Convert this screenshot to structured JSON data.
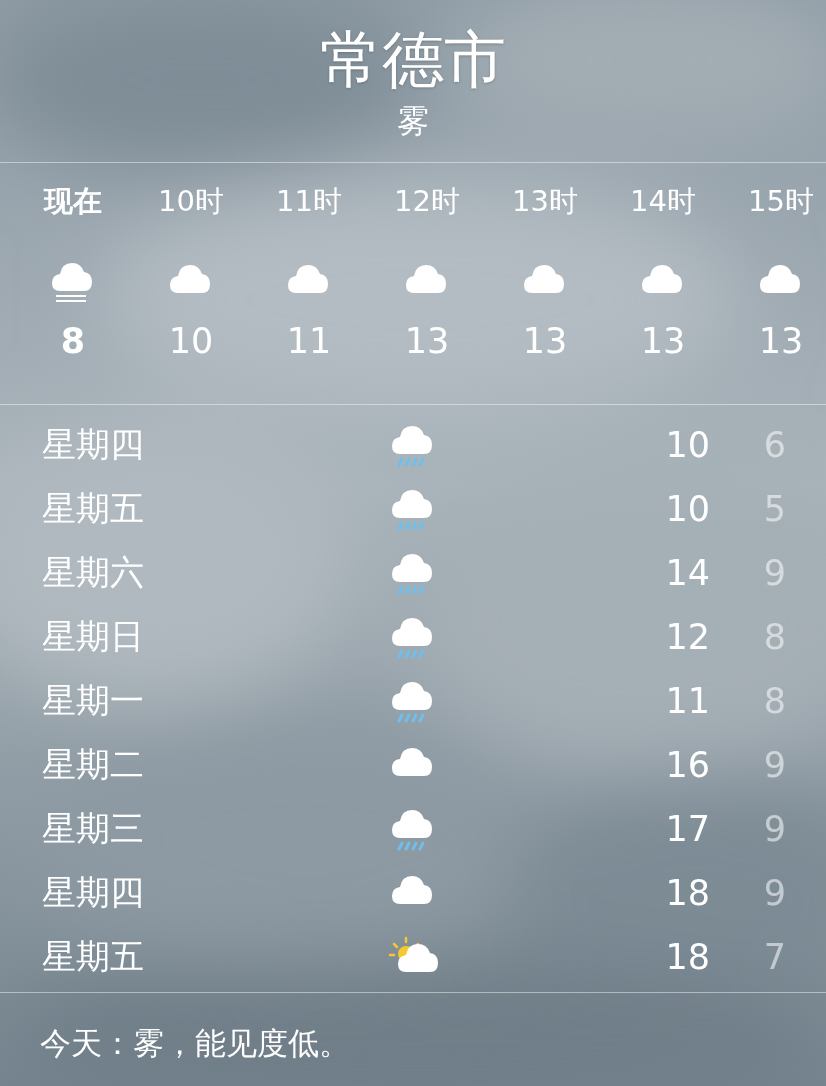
{
  "header": {
    "city": "常德市",
    "condition": "雾"
  },
  "hourly": [
    {
      "time": "现在",
      "kind": "fog",
      "temp": "8",
      "current": true
    },
    {
      "time": "10时",
      "kind": "cloud",
      "temp": "10",
      "current": false
    },
    {
      "time": "11时",
      "kind": "cloud",
      "temp": "11",
      "current": false
    },
    {
      "time": "12时",
      "kind": "cloud",
      "temp": "13",
      "current": false
    },
    {
      "time": "13时",
      "kind": "cloud",
      "temp": "13",
      "current": false
    },
    {
      "time": "14时",
      "kind": "cloud",
      "temp": "13",
      "current": false
    },
    {
      "time": "15时",
      "kind": "cloud",
      "temp": "13",
      "current": false
    }
  ],
  "daily": [
    {
      "day": "星期四",
      "kind": "rain",
      "high": "10",
      "low": "6"
    },
    {
      "day": "星期五",
      "kind": "rain",
      "high": "10",
      "low": "5"
    },
    {
      "day": "星期六",
      "kind": "rain",
      "high": "14",
      "low": "9"
    },
    {
      "day": "星期日",
      "kind": "rain",
      "high": "12",
      "low": "8"
    },
    {
      "day": "星期一",
      "kind": "rain",
      "high": "11",
      "low": "8"
    },
    {
      "day": "星期二",
      "kind": "cloud",
      "high": "16",
      "low": "9"
    },
    {
      "day": "星期三",
      "kind": "rain",
      "high": "17",
      "low": "9"
    },
    {
      "day": "星期四",
      "kind": "cloud",
      "high": "18",
      "low": "9"
    },
    {
      "day": "星期五",
      "kind": "partly_sunny",
      "high": "18",
      "low": "7"
    }
  ],
  "summary": "今天：雾，能见度低。"
}
